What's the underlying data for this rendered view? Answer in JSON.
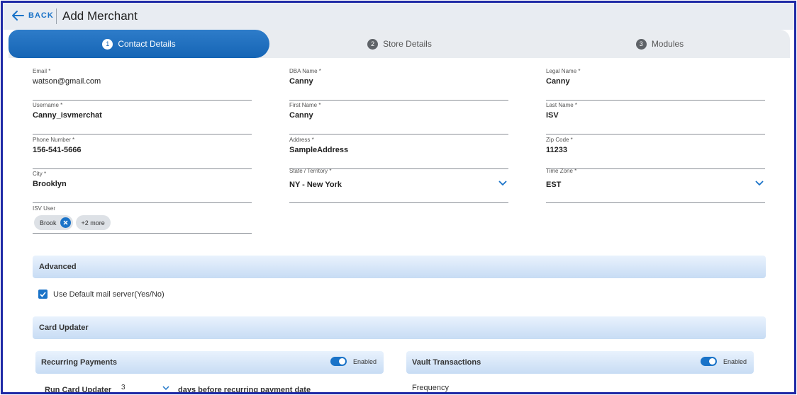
{
  "header": {
    "back_label": "BACK",
    "title": "Add Merchant"
  },
  "tabs": [
    {
      "num": "1",
      "label": "Contact Details",
      "active": true
    },
    {
      "num": "2",
      "label": "Store Details",
      "active": false
    },
    {
      "num": "3",
      "label": "Modules",
      "active": false
    }
  ],
  "form": {
    "email": {
      "label": "Email *",
      "value": "watson@gmail.com"
    },
    "dba_name": {
      "label": "DBA Name *",
      "value": "Canny"
    },
    "legal_name": {
      "label": "Legal Name *",
      "value": "Canny"
    },
    "username": {
      "label": "Username *",
      "value": "Canny_isvmerchat"
    },
    "first_name": {
      "label": "First Name *",
      "value": "Canny"
    },
    "last_name": {
      "label": "Last Name *",
      "value": "ISV"
    },
    "phone": {
      "label": "Phone Number *",
      "value": "156-541-5666"
    },
    "address": {
      "label": "Address *",
      "value": "SampleAddress"
    },
    "zip": {
      "label": "Zip Code *",
      "value": "11233"
    },
    "city": {
      "label": "City *",
      "value": "Brooklyn"
    },
    "state": {
      "label": "State / Territory *",
      "value": "NY - New York"
    },
    "timezone": {
      "label": "Time Zone *",
      "value": "EST"
    },
    "isv_user": {
      "label": "ISV User",
      "chip": "Brook",
      "more": "+2 more"
    }
  },
  "advanced": {
    "title": "Advanced",
    "mail_checkbox_label": "Use Default mail server(Yes/No)",
    "mail_checked": true
  },
  "card_updater": {
    "title": "Card Updater",
    "recurring": {
      "title": "Recurring Payments",
      "toggle_label": "Enabled",
      "enabled": true
    },
    "vault": {
      "title": "Vault Transactions",
      "toggle_label": "Enabled",
      "enabled": true
    },
    "run_label": "Run Card Updater",
    "days_value": "3",
    "days_suffix": "days before recurring payment date",
    "frequency_label": "Frequency"
  },
  "colors": {
    "primary": "#1a73c8",
    "frame_border": "#1f2aa6",
    "section_bg": "#c7dcf4"
  }
}
